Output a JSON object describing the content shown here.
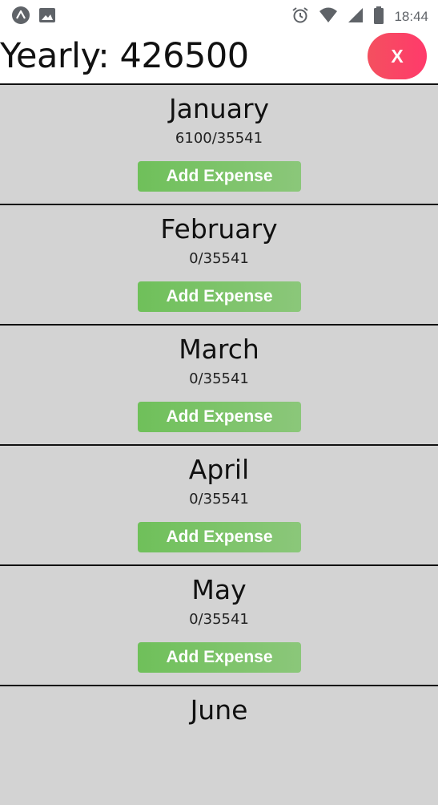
{
  "status_bar": {
    "time": "18:44",
    "left_icons": [
      "expo-icon",
      "image-icon"
    ],
    "right_icons": [
      "alarm-icon",
      "wifi-icon",
      "signal-icon",
      "battery-icon"
    ]
  },
  "header": {
    "yearly_text": "Yearly: 426500",
    "close_label": "X",
    "close_color": "#f4505f"
  },
  "months": [
    {
      "name": "January",
      "budget": "6100/35541",
      "button_label": "Add Expense"
    },
    {
      "name": "February",
      "budget": "0/35541",
      "button_label": "Add Expense"
    },
    {
      "name": "March",
      "budget": "0/35541",
      "button_label": "Add Expense"
    },
    {
      "name": "April",
      "budget": "0/35541",
      "button_label": "Add Expense"
    },
    {
      "name": "May",
      "budget": "0/35541",
      "button_label": "Add Expense"
    },
    {
      "name": "June"
    }
  ],
  "colors": {
    "card_background": "#d3d3d3",
    "button_green": "#6fc05a",
    "divider": "#111111"
  }
}
